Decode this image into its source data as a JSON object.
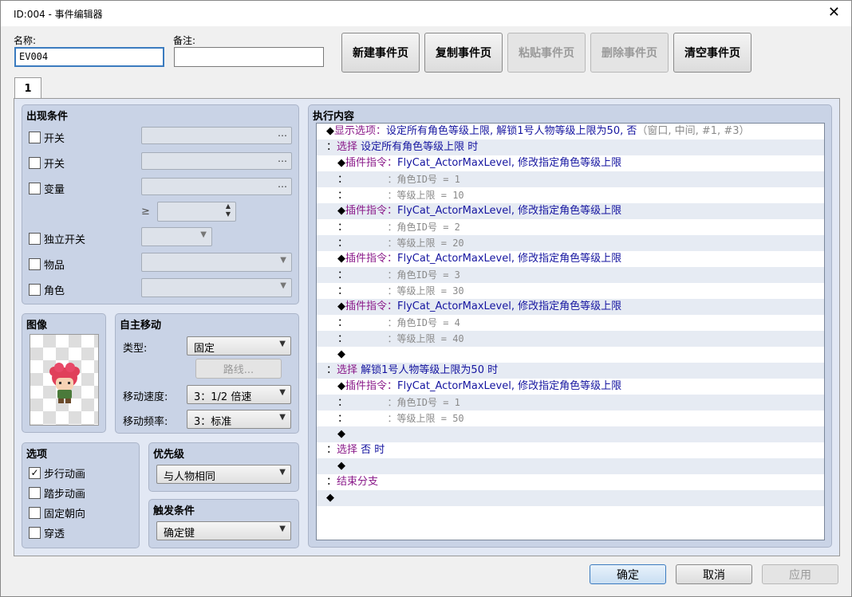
{
  "window": {
    "title": "ID:004 - 事件编辑器",
    "close": "✕"
  },
  "header": {
    "name_label": "名称:",
    "name_value": "EV004",
    "note_label": "备注:",
    "note_value": "",
    "buttons": [
      "新建事件页",
      "复制事件页",
      "粘贴事件页",
      "删除事件页",
      "清空事件页"
    ]
  },
  "tab": "1",
  "conditions": {
    "title": "出现条件",
    "switch1": "开关",
    "switch2": "开关",
    "variable": "变量",
    "ge": "≥",
    "self_switch": "独立开关",
    "item": "物品",
    "actor": "角色",
    "dots": "…"
  },
  "image": {
    "title": "图像"
  },
  "autonomous": {
    "title": "自主移动",
    "type_label": "类型:",
    "type_value": "固定",
    "route_btn": "路线...",
    "speed_label": "移动速度:",
    "speed_value": "3：1/2 倍速",
    "freq_label": "移动频率:",
    "freq_value": "3：标准"
  },
  "options": {
    "title": "选项",
    "items": [
      {
        "label": "步行动画",
        "checked": true
      },
      {
        "label": "踏步动画",
        "checked": false
      },
      {
        "label": "固定朝向",
        "checked": false
      },
      {
        "label": "穿透",
        "checked": false
      }
    ]
  },
  "priority": {
    "title": "优先级",
    "value": "与人物相同"
  },
  "trigger": {
    "title": "触发条件",
    "value": "确定键"
  },
  "contents": {
    "title": "执行内容",
    "rows": [
      {
        "ind": 0,
        "p": "◆",
        "h": "显示选项：",
        "t": "设定所有角色等级上限, 解锁1号人物等级上限为50, 否",
        "g": "（窗口, 中间, #1, #3）"
      },
      {
        "ind": 0,
        "p": "：",
        "h": "选择 ",
        "t": "设定所有角色等级上限 时"
      },
      {
        "ind": 1,
        "p": "◆",
        "h": "插件指令：",
        "t": "FlyCat_ActorMaxLevel, 修改指定角色等级上限"
      },
      {
        "ind": 1,
        "p": "：",
        "sub": "：角色ID号 = 1"
      },
      {
        "ind": 1,
        "p": "：",
        "sub": "：等级上限 = 10"
      },
      {
        "ind": 1,
        "p": "◆",
        "h": "插件指令：",
        "t": "FlyCat_ActorMaxLevel, 修改指定角色等级上限"
      },
      {
        "ind": 1,
        "p": "：",
        "sub": "：角色ID号 = 2"
      },
      {
        "ind": 1,
        "p": "：",
        "sub": "：等级上限 = 20"
      },
      {
        "ind": 1,
        "p": "◆",
        "h": "插件指令：",
        "t": "FlyCat_ActorMaxLevel, 修改指定角色等级上限"
      },
      {
        "ind": 1,
        "p": "：",
        "sub": "：角色ID号 = 3"
      },
      {
        "ind": 1,
        "p": "：",
        "sub": "：等级上限 = 30"
      },
      {
        "ind": 1,
        "p": "◆",
        "h": "插件指令：",
        "t": "FlyCat_ActorMaxLevel, 修改指定角色等级上限"
      },
      {
        "ind": 1,
        "p": "：",
        "sub": "：角色ID号 = 4"
      },
      {
        "ind": 1,
        "p": "：",
        "sub": "：等级上限 = 40"
      },
      {
        "ind": 1,
        "p": "◆"
      },
      {
        "ind": 0,
        "p": "：",
        "h": "选择 ",
        "t": "解锁1号人物等级上限为50 时"
      },
      {
        "ind": 1,
        "p": "◆",
        "h": "插件指令：",
        "t": "FlyCat_ActorMaxLevel, 修改指定角色等级上限"
      },
      {
        "ind": 1,
        "p": "：",
        "sub": "：角色ID号 = 1"
      },
      {
        "ind": 1,
        "p": "：",
        "sub": "：等级上限 = 50"
      },
      {
        "ind": 1,
        "p": "◆"
      },
      {
        "ind": 0,
        "p": "：",
        "h": "选择 ",
        "t": "否 时"
      },
      {
        "ind": 1,
        "p": "◆"
      },
      {
        "ind": 0,
        "p": "：",
        "h": "结束分支"
      },
      {
        "ind": 0,
        "p": "◆"
      },
      {
        "ind": 0,
        "p": ""
      }
    ]
  },
  "footer": {
    "ok": "确定",
    "cancel": "取消",
    "apply": "应用"
  },
  "colors": {
    "command": "#8a1a8a",
    "text": "#1515a0",
    "param": "#8a8a8a"
  }
}
